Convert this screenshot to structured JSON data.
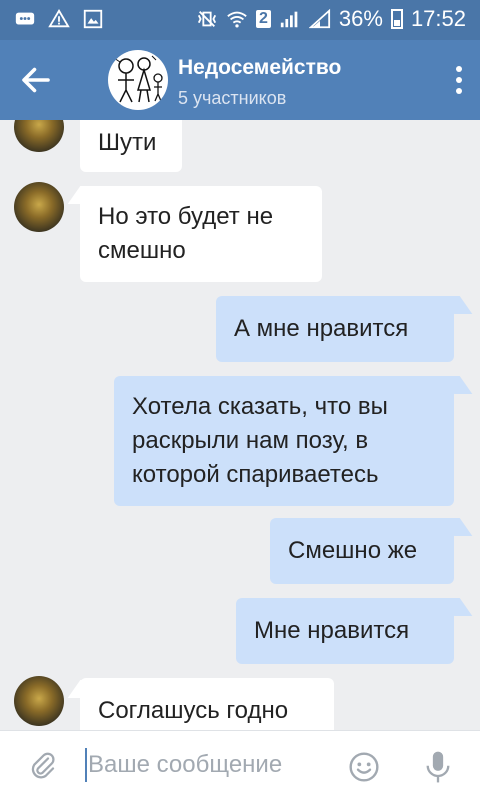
{
  "statusbar": {
    "battery": "36%",
    "time": "17:52",
    "sim_label": "2"
  },
  "header": {
    "title": "Недосемейство",
    "subtitle": "5 участников"
  },
  "messages": [
    {
      "direction": "in",
      "lines": [
        "Шути"
      ]
    },
    {
      "direction": "in",
      "lines": [
        "Но это будет не",
        "смешно"
      ]
    },
    {
      "direction": "out",
      "lines": [
        "А мне нравится"
      ]
    },
    {
      "direction": "out",
      "lines": [
        "Хотела сказать, что вы",
        "раскрыли нам позу, в",
        "которой спариваетесь"
      ]
    },
    {
      "direction": "out",
      "lines": [
        "Смешно же"
      ]
    },
    {
      "direction": "out",
      "lines": [
        "Мне нравится"
      ]
    },
    {
      "direction": "in",
      "lines": [
        "Соглашусь годно"
      ]
    }
  ],
  "composer": {
    "placeholder": "Ваше сообщение",
    "value": ""
  },
  "colors": {
    "header": "#5181b8",
    "statusbar": "#4a76a8",
    "chat_bg": "#edeef0",
    "incoming": "#ffffff",
    "outgoing": "#cce0fa"
  }
}
